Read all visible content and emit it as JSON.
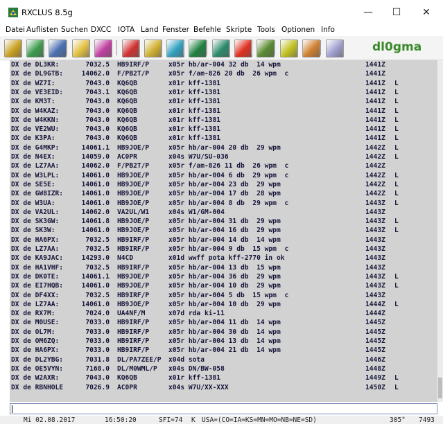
{
  "window": {
    "title": "RXCLUS 8.5g",
    "minimize": "—",
    "maximize": "☐",
    "close": "✕"
  },
  "menu": [
    "Datei",
    "Auflisten",
    "Suchen",
    "DXCC",
    "IOTA",
    "Land",
    "Fenster",
    "Befehle",
    "Skripte",
    "Tools",
    "Optionen",
    "Info"
  ],
  "toolbar": {
    "callsign": "dl0gma",
    "buttons": [
      {
        "name": "satellite-icon",
        "color": "#c9a020"
      },
      {
        "name": "antenna-icon",
        "color": "#3a9a4a"
      },
      {
        "name": "pencil-icon",
        "color": "#4a70b0"
      },
      {
        "name": "dx-search-icon",
        "color": "#e0c040"
      },
      {
        "name": "globe-icon",
        "color": "#c040a0"
      },
      {
        "name": "red-book-icon",
        "color": "#d03030"
      },
      {
        "name": "chart-icon",
        "color": "#d0b030"
      },
      {
        "name": "list-icon",
        "color": "#30a0c0"
      },
      {
        "name": "map-icon",
        "color": "#208040"
      },
      {
        "name": "tower-icon",
        "color": "#2a8a6a"
      },
      {
        "name": "alarm-icon",
        "color": "#e03020"
      },
      {
        "name": "grid-icon",
        "color": "#5a8a30"
      },
      {
        "name": "filter-icon",
        "color": "#c0c020"
      },
      {
        "name": "edit-icon",
        "color": "#d08030"
      },
      {
        "name": "speaker-icon",
        "color": "#a0a0d0"
      }
    ]
  },
  "spots": [
    {
      "de": "DX de DL3KR:",
      "freq": "7032.5",
      "dx": "HB9IRF/P",
      "comment": "x05r hb/ar-004 32 db  14 wpm",
      "time": "1441Z",
      "flag": ""
    },
    {
      "de": "DX de DL9GTB:",
      "freq": "14062.0",
      "dx": "F/PB2T/P",
      "comment": "x05r f/am-826 20 db  26 wpm  c",
      "time": "1441Z",
      "flag": ""
    },
    {
      "de": "DX de WZ7I:",
      "freq": "7043.0",
      "dx": "KQ6QB",
      "comment": "x01r kff-1381",
      "time": "1441Z",
      "flag": "L"
    },
    {
      "de": "DX de VE3EID:",
      "freq": "7043.1",
      "dx": "KQ6QB",
      "comment": "x01r kff-1381",
      "time": "1441Z",
      "flag": "L"
    },
    {
      "de": "DX de KM3T:",
      "freq": "7043.0",
      "dx": "KQ6QB",
      "comment": "x01r kff-1381",
      "time": "1441Z",
      "flag": "L"
    },
    {
      "de": "DX de W4KAZ:",
      "freq": "7043.0",
      "dx": "KQ6QB",
      "comment": "x01r kff-1381",
      "time": "1441Z",
      "flag": "L"
    },
    {
      "de": "DX de W4KKN:",
      "freq": "7043.0",
      "dx": "KQ6QB",
      "comment": "x01r kff-1381",
      "time": "1441Z",
      "flag": "L"
    },
    {
      "de": "DX de VE2WU:",
      "freq": "7043.0",
      "dx": "KQ6QB",
      "comment": "x01r kff-1381",
      "time": "1441Z",
      "flag": "L"
    },
    {
      "de": "DX de K3PA:",
      "freq": "7043.0",
      "dx": "KQ6QB",
      "comment": "x01r kff-1381",
      "time": "1441Z",
      "flag": "L"
    },
    {
      "de": "DX de G4MKP:",
      "freq": "14061.1",
      "dx": "HB9JOE/P",
      "comment": "x05r hb/ar-004 20 db  29 wpm",
      "time": "1442Z",
      "flag": "L"
    },
    {
      "de": "DX de N4EX:",
      "freq": "14059.0",
      "dx": "AC0PR",
      "comment": "x04s W7U/SU-036",
      "time": "1442Z",
      "flag": "L"
    },
    {
      "de": "DX de LZ7AA:",
      "freq": "14062.0",
      "dx": "F/PB2T/P",
      "comment": "x05r f/am-826 11 db  26 wpm  c",
      "time": "1442Z",
      "flag": ""
    },
    {
      "de": "DX de W3LPL:",
      "freq": "14061.0",
      "dx": "HB9JOE/P",
      "comment": "x05r hb/ar-004 6 db  29 wpm  c",
      "time": "1442Z",
      "flag": "L"
    },
    {
      "de": "DX de SE5E:",
      "freq": "14061.0",
      "dx": "HB9JOE/P",
      "comment": "x05r hb/ar-004 23 db  29 wpm",
      "time": "1442Z",
      "flag": "L"
    },
    {
      "de": "DX de GW8IZR:",
      "freq": "14061.0",
      "dx": "HB9JOE/P",
      "comment": "x05r hb/ar-004 17 db  28 wpm",
      "time": "1442Z",
      "flag": "L"
    },
    {
      "de": "DX de W3UA:",
      "freq": "14061.0",
      "dx": "HB9JOE/P",
      "comment": "x05r hb/ar-004 8 db  29 wpm  c",
      "time": "1443Z",
      "flag": "L"
    },
    {
      "de": "DX de VA2UL:",
      "freq": "14062.0",
      "dx": "VA2UL/W1",
      "comment": "x04s W1/GM-004",
      "time": "1443Z",
      "flag": ""
    },
    {
      "de": "DX de SK3GW:",
      "freq": "14061.8",
      "dx": "HB9JOE/P",
      "comment": "x05r hb/ar-004 31 db  29 wpm",
      "time": "1443Z",
      "flag": "L"
    },
    {
      "de": "DX de SK3W:",
      "freq": "14061.0",
      "dx": "HB9JOE/P",
      "comment": "x05r hb/ar-004 16 db  29 wpm",
      "time": "1443Z",
      "flag": "L"
    },
    {
      "de": "DX de HA6PX:",
      "freq": "7032.5",
      "dx": "HB9IRF/P",
      "comment": "x05r hb/ar-004 14 db  14 wpm",
      "time": "1443Z",
      "flag": ""
    },
    {
      "de": "DX de LZ7AA:",
      "freq": "7032.5",
      "dx": "HB9IRF/P",
      "comment": "x05r hb/ar-004 9 db  15 wpm  c",
      "time": "1443Z",
      "flag": ""
    },
    {
      "de": "DX de KA9JAC:",
      "freq": "14293.0",
      "dx": "N4CD",
      "comment": "x01d wwff pota kff-2770 in ok",
      "time": "1443Z",
      "flag": ""
    },
    {
      "de": "DX de HA1VHF:",
      "freq": "7032.5",
      "dx": "HB9IRF/P",
      "comment": "x05r hb/ar-004 13 db  15 wpm",
      "time": "1443Z",
      "flag": ""
    },
    {
      "de": "DX de DK0TE:",
      "freq": "14061.1",
      "dx": "HB9JOE/P",
      "comment": "x05r hb/ar-004 36 db  29 wpm",
      "time": "1443Z",
      "flag": "L"
    },
    {
      "de": "DX de EI7HQB:",
      "freq": "14061.0",
      "dx": "HB9JOE/P",
      "comment": "x05r hb/ar-004 10 db  29 wpm",
      "time": "1443Z",
      "flag": "L"
    },
    {
      "de": "DX de DF4XX:",
      "freq": "7032.5",
      "dx": "HB9IRF/P",
      "comment": "x05r hb/ar-004 5 db  15 wpm  c",
      "time": "1443Z",
      "flag": ""
    },
    {
      "de": "DX de LZ7AA:",
      "freq": "14061.0",
      "dx": "HB9JOE/P",
      "comment": "x05r hb/ar-004 10 db  29 wpm",
      "time": "1444Z",
      "flag": "L"
    },
    {
      "de": "DX de RX7M:",
      "freq": "7024.0",
      "dx": "UA4NF/M",
      "comment": "x07d rda ki-11",
      "time": "1444Z",
      "flag": ""
    },
    {
      "de": "DX de M0USE:",
      "freq": "7033.0",
      "dx": "HB9IRF/P",
      "comment": "x05r hb/ar-004 11 db  14 wpm",
      "time": "1445Z",
      "flag": ""
    },
    {
      "de": "DX de OL7M:",
      "freq": "7033.0",
      "dx": "HB9IRF/P",
      "comment": "x05r hb/ar-004 30 db  14 wpm",
      "time": "1445Z",
      "flag": ""
    },
    {
      "de": "DX de OM6ZQ:",
      "freq": "7033.0",
      "dx": "HB9IRF/P",
      "comment": "x05r hb/ar-004 13 db  14 wpm",
      "time": "1445Z",
      "flag": ""
    },
    {
      "de": "DX de HA6PX:",
      "freq": "7033.0",
      "dx": "HB9IRF/P",
      "comment": "x05r hb/ar-004 21 db  14 wpm",
      "time": "1445Z",
      "flag": ""
    },
    {
      "de": "DX de DL2YBG:",
      "freq": "7031.8",
      "dx": "DL/PA7ZEE/P",
      "comment": "x04d sota",
      "time": "1446Z",
      "flag": ""
    },
    {
      "de": "DX de OE5VYN:",
      "freq": "7168.0",
      "dx": "DL/M0WML/P",
      "comment": "x04s DN/BW-058",
      "time": "1448Z",
      "flag": ""
    },
    {
      "de": "DX de W2AXR:",
      "freq": "7043.0",
      "dx": "KQ6QB",
      "comment": "x01r kff-1381",
      "time": "1449Z",
      "flag": "L"
    },
    {
      "de": "DX de RBNHOLE",
      "freq": "7026.9",
      "dx": "AC0PR",
      "comment": "x04s W7U/XX-XXX",
      "time": "1450Z",
      "flag": "L"
    }
  ],
  "status": {
    "date": "Mi 02.08.2017",
    "time": "16:50:20",
    "sfi": "SFI=74",
    "kindex": "K",
    "info": "USA=(CO=IA=KS=MN=MO=NB=NE=SD)",
    "bearing": "305°",
    "extra": "7493"
  }
}
